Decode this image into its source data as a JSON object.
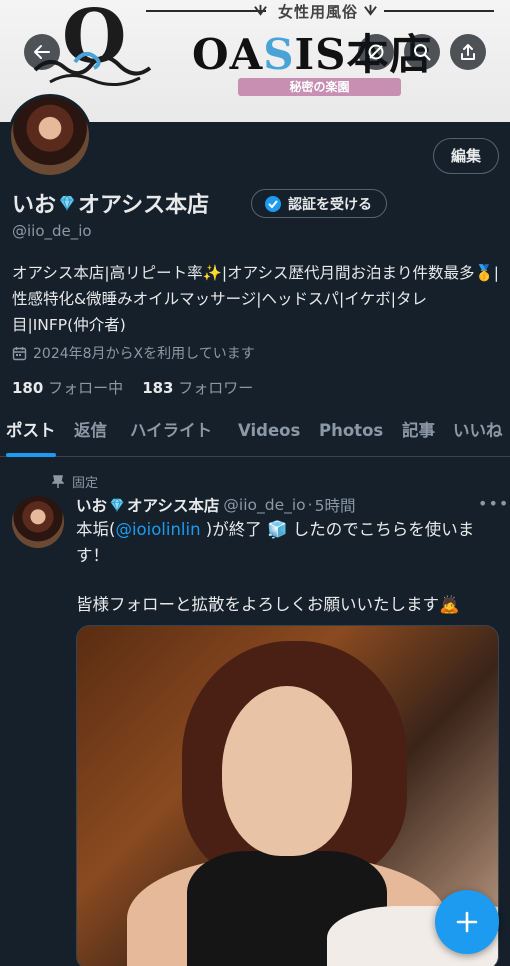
{
  "banner": {
    "subtitle": "女性用風俗",
    "brand_pre": "OA",
    "brand_s": "S",
    "brand_post": "IS本店",
    "tagline": "秘密の楽園",
    "logo_letter": "O"
  },
  "profile": {
    "name_part1": "いお",
    "name_part2": "オアシス本店",
    "handle": "@iio_de_io",
    "edit_label": "編集",
    "verify_label": "認証を受ける",
    "bio": "オアシス本店|高リピート率✨|オアシス歴代月間お泊まり件数最多🥇|性感特化&微睡みオイルマッサージ|ヘッドスパ|イケボ|タレ目|INFP(仲介者)",
    "joined": "2024年8月からXを利用しています",
    "following_count": "180",
    "following_label": "フォロー中",
    "followers_count": "183",
    "followers_label": "フォロワー"
  },
  "tabs": [
    {
      "label": "ポスト",
      "active": true
    },
    {
      "label": "返信"
    },
    {
      "label": "ハイライト"
    },
    {
      "label": "Videos"
    },
    {
      "label": "Photos"
    },
    {
      "label": "記事"
    },
    {
      "label": "いいね"
    }
  ],
  "tweet": {
    "pinned_label": "固定",
    "author_part1": "いお",
    "author_part2": "オアシス本店",
    "handle": "@iio_de_io",
    "time": "5時間",
    "text_pre": "本垢(",
    "mention": "@ioiolinlin",
    "text_post": " )が終了 🧊 したのでこちらを使います！",
    "text2": "皆様フォローと拡散をよろしくお願いいたします🙇"
  },
  "colors": {
    "background": "#15202b",
    "accent": "#1d9bf0",
    "secondary_text": "#8b98a5"
  }
}
